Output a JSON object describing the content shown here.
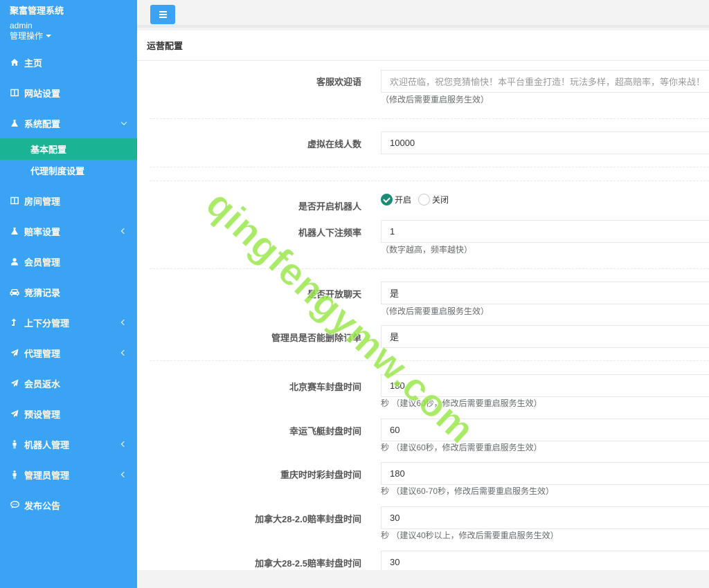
{
  "brand": {
    "app_title": "聚富管理系统",
    "user": "admin",
    "ops_label": "管理操作"
  },
  "nav": {
    "home": "主页",
    "site_settings": "网站设置",
    "system_config": "系统配置",
    "basic_config": "基本配置",
    "agent_system_settings": "代理制度设置",
    "room_management": "房间管理",
    "odds_settings": "赔率设置",
    "member_management": "会员管理",
    "guess_records": "竞猜记录",
    "points_management": "上下分管理",
    "agent_management": "代理管理",
    "member_rebate": "会员返水",
    "preset_management": "预设管理",
    "robot_management": "机器人管理",
    "admin_management": "管理员管理",
    "publish_notice": "发布公告"
  },
  "panel": {
    "title": "运营配置"
  },
  "form": {
    "welcome": {
      "label": "客服欢迎语",
      "placeholder": "欢迎莅临，祝您竞猜愉快！本平台重金打造！玩法多样，超高赔率，等你来战！",
      "help": "（修改后需要重启服务生效）"
    },
    "virtual_online": {
      "label": "虚拟在线人数",
      "value": "10000"
    },
    "robot_enable": {
      "label": "是否开启机器人",
      "option_on": "开启",
      "option_off": "关闭",
      "selected": "开启"
    },
    "robot_bet_freq": {
      "label": "机器人下注频率",
      "value": "1",
      "help": "（数字越高，频率越快）"
    },
    "open_chat": {
      "label": "是否开放聊天",
      "value": "是",
      "help": "（修改后需要重启服务生效）"
    },
    "admin_delete_order": {
      "label": "管理员是否能删除订单",
      "value": "是"
    },
    "beijing_close": {
      "label": "北京赛车封盘时间",
      "value": "180",
      "help": "秒 （建议60秒，修改后需要重启服务生效）"
    },
    "lucky_boat_close": {
      "label": "幸运飞艇封盘时间",
      "value": "60",
      "help": "秒 （建议60秒，修改后需要重启服务生效）"
    },
    "chongqing_close": {
      "label": "重庆时时彩封盘时间",
      "value": "180",
      "help": "秒 （建议60-70秒，修改后需要重启服务生效）"
    },
    "canada_20_close": {
      "label": "加拿大28-2.0赔率封盘时间",
      "value": "30",
      "help": "秒 （建议40秒以上，修改后需要重启服务生效）"
    },
    "canada_25_close": {
      "label": "加拿大28-2.5赔率封盘时间",
      "value": "30"
    }
  },
  "watermark": "qingfengymw.com"
}
